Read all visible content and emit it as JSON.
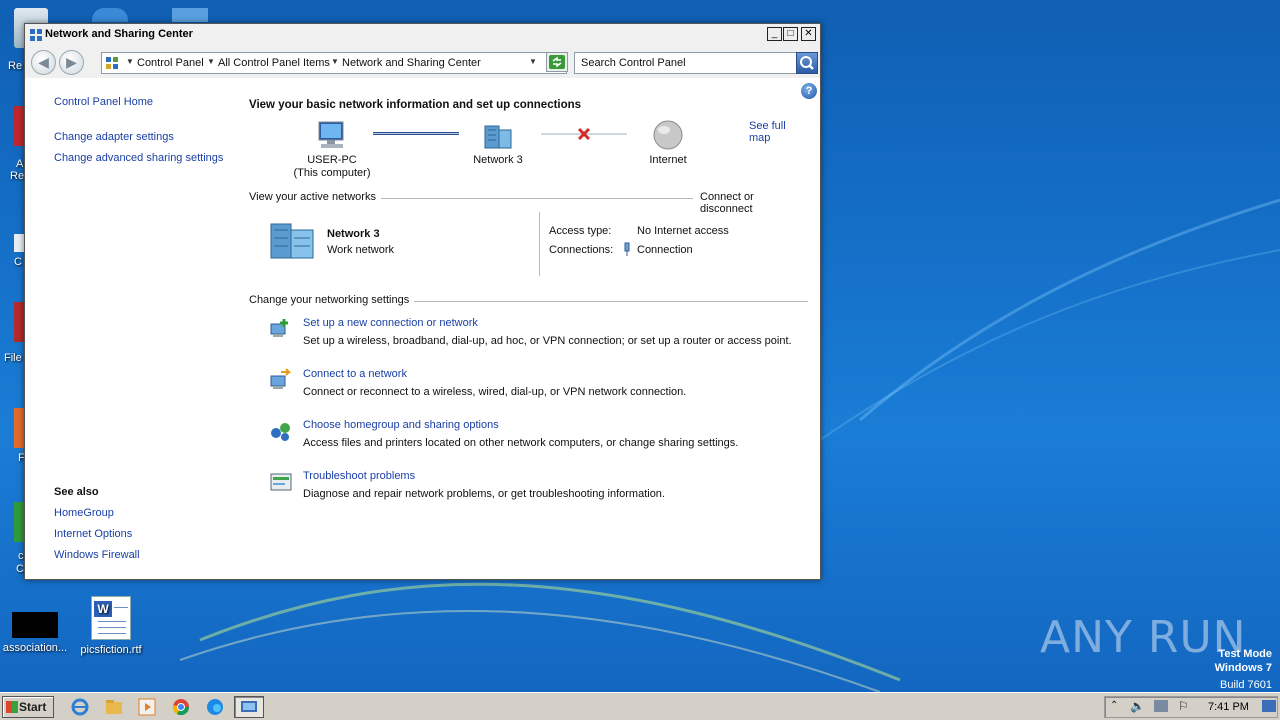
{
  "window": {
    "title": "Network and Sharing Center"
  },
  "address": {
    "crumbs": [
      "Control Panel",
      "All Control Panel Items",
      "Network and Sharing Center"
    ],
    "search_placeholder": "Search Control Panel"
  },
  "leftnav": {
    "home": "Control Panel Home",
    "links": [
      "Change adapter settings",
      "Change advanced sharing settings"
    ],
    "see_also_title": "See also",
    "see_also": [
      "HomeGroup",
      "Internet Options",
      "Windows Firewall"
    ]
  },
  "main": {
    "heading": "View your basic network information and set up connections",
    "see_full_map": "See full map",
    "map": {
      "computer_name": "USER-PC",
      "computer_sub": "(This computer)",
      "network": "Network  3",
      "internet": "Internet"
    },
    "active_title": "View your active networks",
    "connect_disconnect": "Connect or disconnect",
    "active": {
      "name": "Network  3",
      "type": "Work network",
      "access_label": "Access type:",
      "access_value": "No Internet access",
      "connections_label": "Connections:",
      "connections_value": "Connection"
    },
    "settings_title": "Change your networking settings",
    "tasks": [
      {
        "title": "Set up a new connection or network",
        "desc": "Set up a wireless, broadband, dial-up, ad hoc, or VPN connection; or set up a router or access point."
      },
      {
        "title": "Connect to a network",
        "desc": "Connect or reconnect to a wireless, wired, dial-up, or VPN network connection."
      },
      {
        "title": "Choose homegroup and sharing options",
        "desc": "Access files and printers located on other network computers, or change sharing settings."
      },
      {
        "title": "Troubleshoot problems",
        "desc": "Diagnose and repair network problems, or get troubleshooting information."
      }
    ]
  },
  "desktop": {
    "icons": [
      "association...",
      "picsfiction.rtf"
    ],
    "partial_labels": [
      "Re",
      "A",
      "Re",
      "C",
      "File",
      "F",
      "c",
      "C"
    ]
  },
  "taskbar": {
    "start": "Start",
    "clock": "7:41 PM"
  },
  "watermark": {
    "line1": "Test Mode",
    "line2": "Windows 7",
    "line3": "Build 7601",
    "brand": "ANY RUN"
  },
  "colors": {
    "link": "#1a3fa5",
    "desktop": "#1570c8",
    "error_x": "#d42a2a"
  }
}
